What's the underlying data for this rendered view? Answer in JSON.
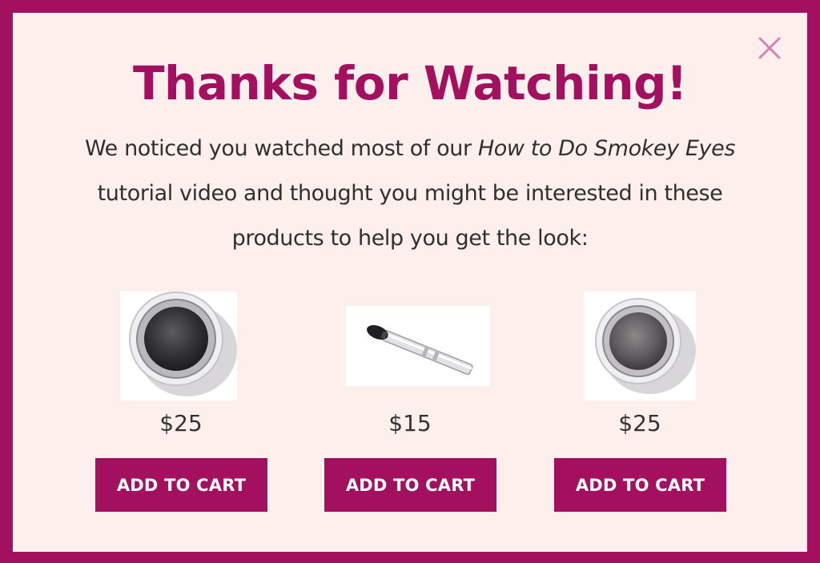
{
  "modal": {
    "title": "Thanks for Watching!",
    "message": {
      "part1": "We noticed you watched most of our ",
      "video_title": "How to Do Smokey Eyes",
      "part2": " tutorial video and thought you might be interested in these products to help you get the look:"
    },
    "close_icon": "close-icon"
  },
  "products": [
    {
      "image": "black-eyeshadow-pot",
      "price": "$25",
      "button_label": "ADD TO CART"
    },
    {
      "image": "eyeshadow-applicator-brush",
      "price": "$15",
      "button_label": "ADD TO CART"
    },
    {
      "image": "gray-eyeshadow-pot",
      "price": "$25",
      "button_label": "ADD TO CART"
    }
  ],
  "colors": {
    "accent": "#a3105f",
    "background": "#fdf0ec",
    "text": "#2f2f2f",
    "button_text": "#ffffff",
    "close": "#d77fb4"
  }
}
